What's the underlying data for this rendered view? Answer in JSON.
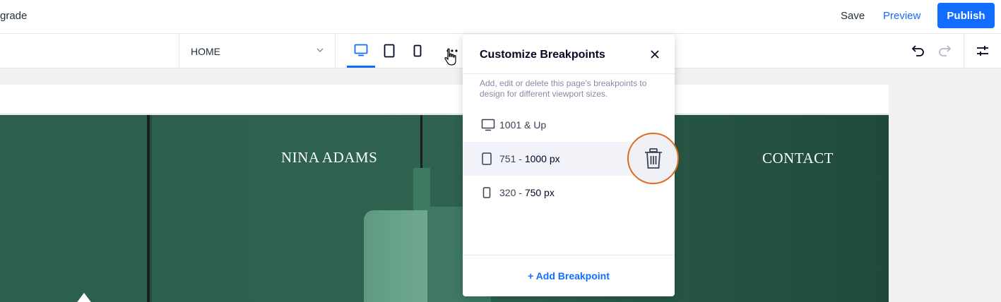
{
  "topbar": {
    "upgrade_label": "grade",
    "save_label": "Save",
    "preview_label": "Preview",
    "publish_label": "Publish"
  },
  "toolbar": {
    "page_select": {
      "value": "HOME"
    },
    "devices": [
      "desktop",
      "tablet",
      "mobile"
    ],
    "active_device": "desktop"
  },
  "site": {
    "nav_name": "NINA ADAMS",
    "nav_contact": "CONTACT"
  },
  "breakpoints_panel": {
    "title": "Customize Breakpoints",
    "description": "Add, edit or delete this page's breakpoints to design for different viewport sizes.",
    "rows": [
      {
        "icon": "desktop-icon",
        "label_start": "1001 & Up",
        "label_end": ""
      },
      {
        "icon": "tablet-icon",
        "label_start": "751 - ",
        "label_end": "1000 px"
      },
      {
        "icon": "mobile-icon",
        "label_start": "320 - ",
        "label_end": "750 px"
      }
    ],
    "add_label": "+ Add Breakpoint"
  },
  "colors": {
    "accent": "#116dff",
    "highlight_ring": "#e06b1f",
    "hero_green": "#2c5f4d"
  }
}
